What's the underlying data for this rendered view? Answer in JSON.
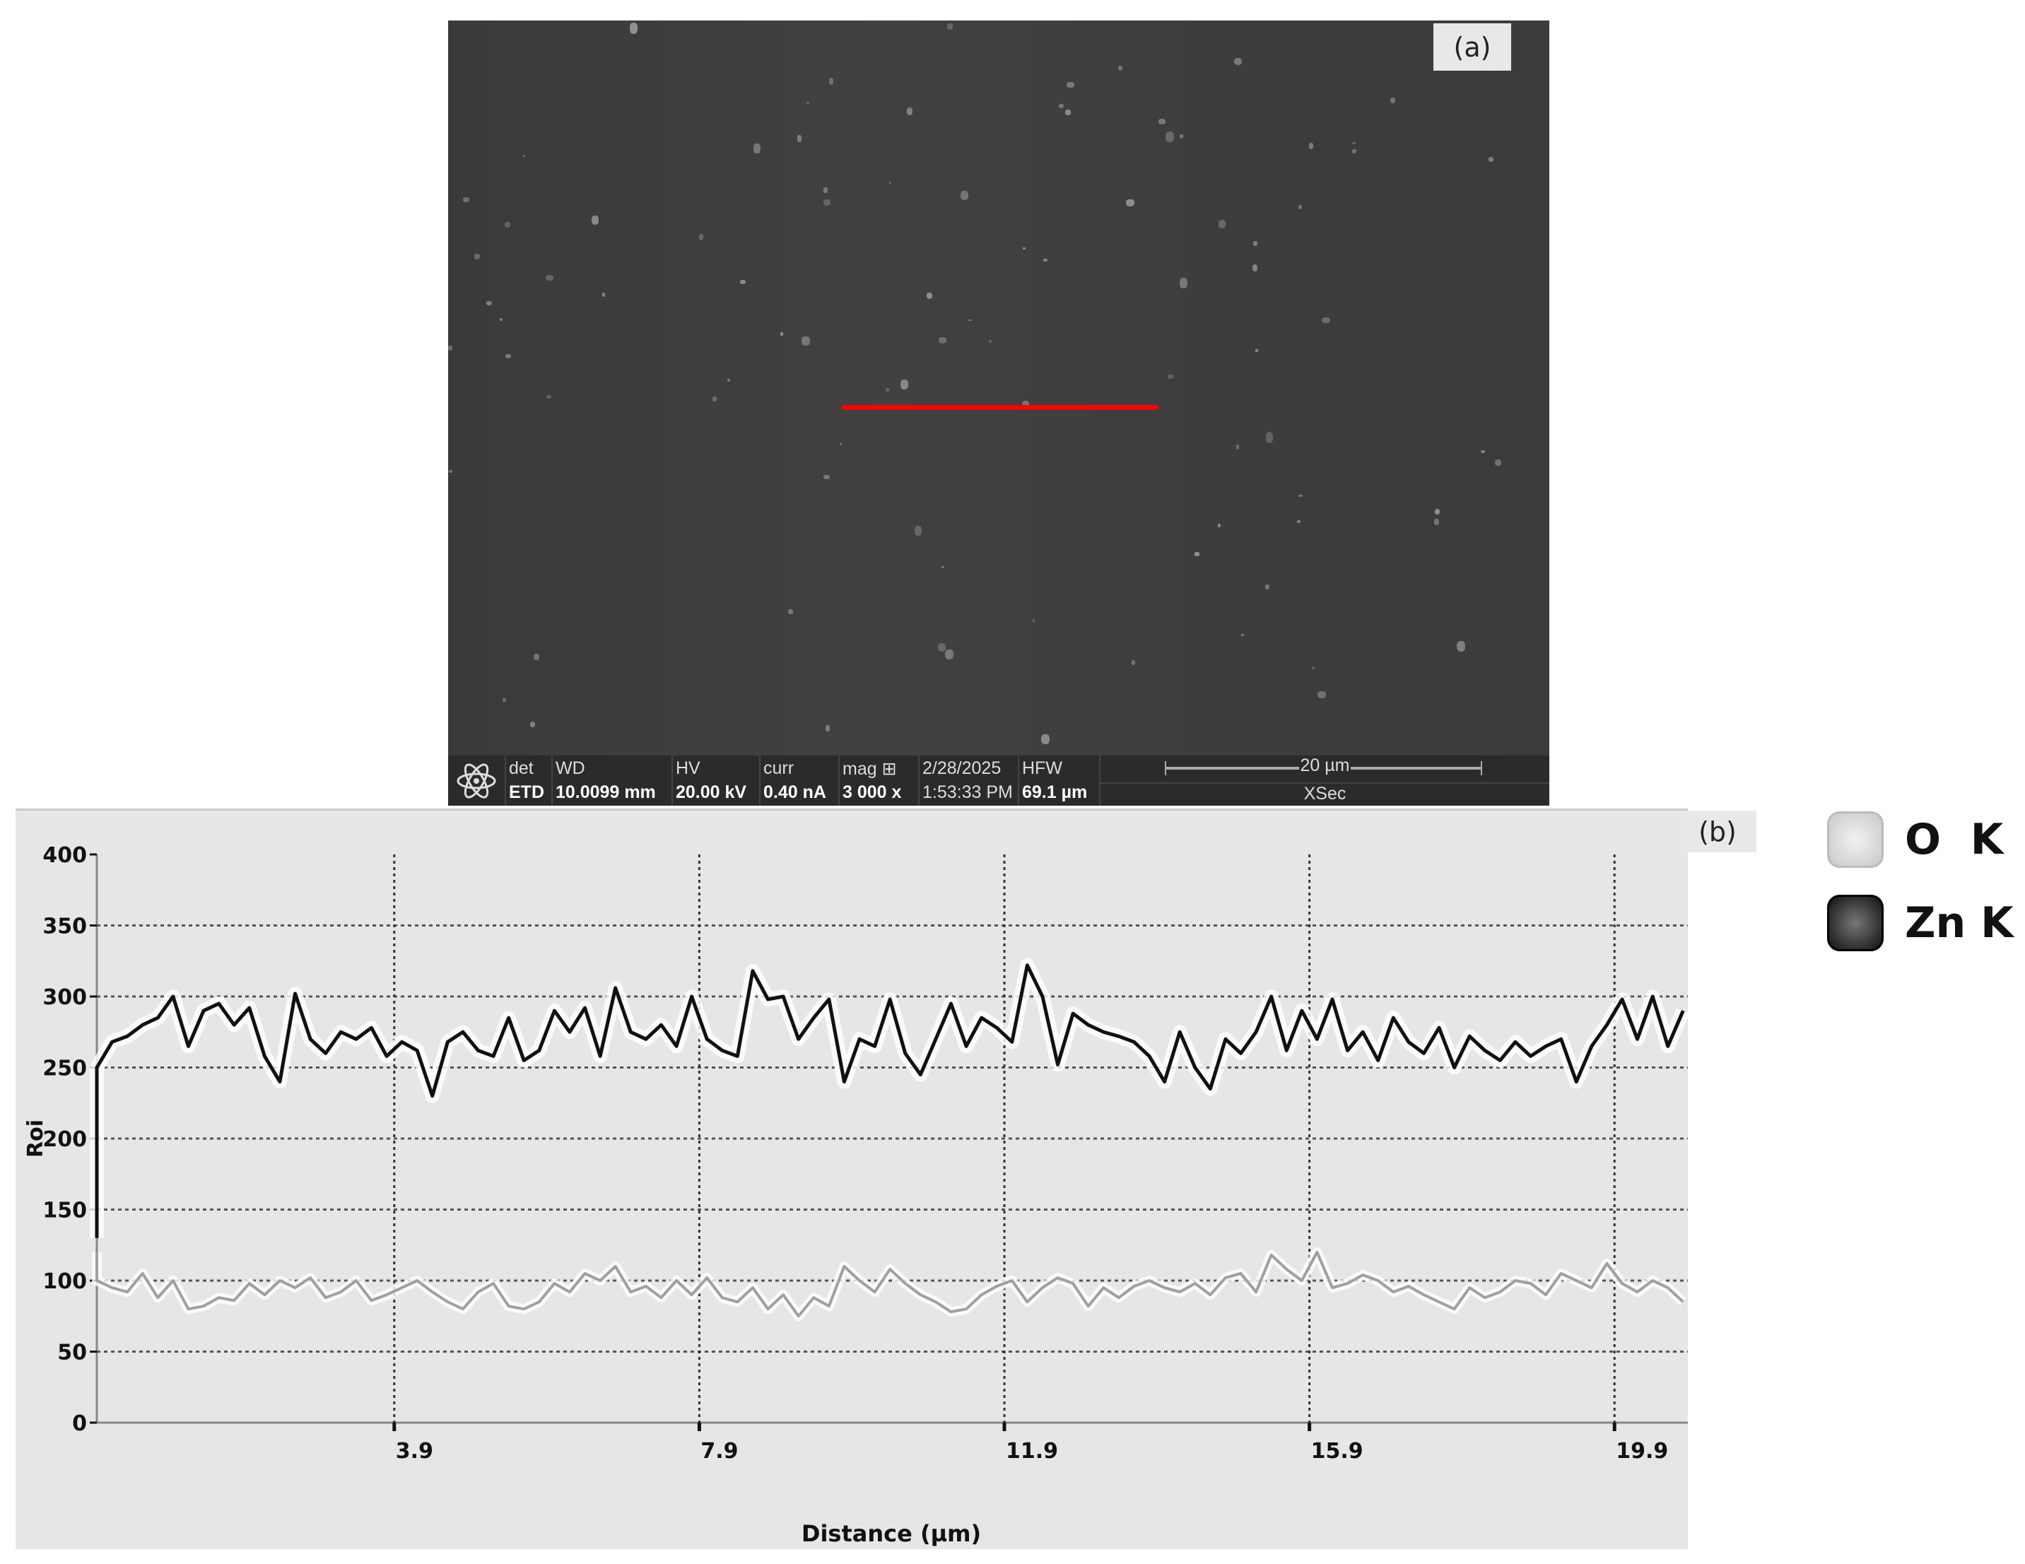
{
  "panel_a": {
    "label": "(a)",
    "info": [
      {
        "label": "det",
        "value": "ETD"
      },
      {
        "label": "WD",
        "value": "10.0099 mm"
      },
      {
        "label": "HV",
        "value": "20.00 kV"
      },
      {
        "label": "curr",
        "value": "0.40 nA"
      },
      {
        "label": "mag ⊞",
        "value": "3 000 x"
      },
      {
        "label": "2/28/2025",
        "value": "1:53:33 PM"
      },
      {
        "label": "HFW",
        "value": "69.1 µm"
      }
    ],
    "scale_bar": "20 µm",
    "mode": "XSec",
    "line_color": "#ff0000"
  },
  "chart_data": {
    "type": "line",
    "panel_label": "(b)",
    "xlabel": "Distance (µm)",
    "ylabel": "Roi",
    "xlim": [
      0,
      20.9
    ],
    "ylim": [
      0,
      400
    ],
    "yticks": [
      "0",
      "50",
      "100",
      "150",
      "200",
      "250",
      "300",
      "350",
      "400"
    ],
    "xticks": [
      "3.9",
      "7.9",
      "11.9",
      "15.9",
      "19.9"
    ],
    "grid": true,
    "legend_placement": "right-outside",
    "x_step": 0.2,
    "series": [
      {
        "name": "O  K",
        "color": "#a0a0a0",
        "values": [
          100,
          95,
          92,
          105,
          88,
          100,
          80,
          82,
          88,
          86,
          98,
          90,
          100,
          95,
          102,
          88,
          92,
          100,
          86,
          90,
          95,
          100,
          92,
          85,
          80,
          92,
          98,
          82,
          80,
          85,
          98,
          92,
          105,
          100,
          110,
          92,
          96,
          88,
          100,
          90,
          102,
          88,
          85,
          95,
          80,
          90,
          75,
          88,
          82,
          110,
          100,
          92,
          108,
          98,
          90,
          85,
          78,
          80,
          90,
          96,
          100,
          85,
          95,
          102,
          98,
          82,
          95,
          88,
          96,
          100,
          95,
          92,
          98,
          90,
          102,
          105,
          92,
          118,
          108,
          100,
          120,
          95,
          98,
          104,
          100,
          92,
          96,
          90,
          85,
          80,
          95,
          88,
          92,
          100,
          98,
          90,
          105,
          100,
          95,
          112,
          98,
          92,
          100,
          95,
          85
        ]
      },
      {
        "name": "Zn K",
        "color": "#111111",
        "values": [
          250,
          268,
          272,
          280,
          285,
          300,
          265,
          290,
          295,
          280,
          292,
          258,
          240,
          302,
          270,
          260,
          275,
          270,
          278,
          258,
          268,
          262,
          230,
          268,
          275,
          262,
          258,
          285,
          255,
          262,
          290,
          275,
          292,
          258,
          306,
          275,
          270,
          280,
          265,
          300,
          270,
          262,
          258,
          318,
          298,
          300,
          270,
          285,
          298,
          240,
          270,
          265,
          298,
          260,
          245,
          270,
          295,
          265,
          285,
          278,
          268,
          322,
          300,
          252,
          288,
          280,
          275,
          272,
          268,
          258,
          240,
          275,
          250,
          235,
          270,
          260,
          275,
          300,
          262,
          290,
          270,
          298,
          262,
          275,
          255,
          285,
          268,
          260,
          278,
          250,
          272,
          262,
          255,
          268,
          258,
          265,
          270,
          240,
          265,
          280,
          298,
          270,
          300,
          265,
          290
        ]
      }
    ]
  }
}
